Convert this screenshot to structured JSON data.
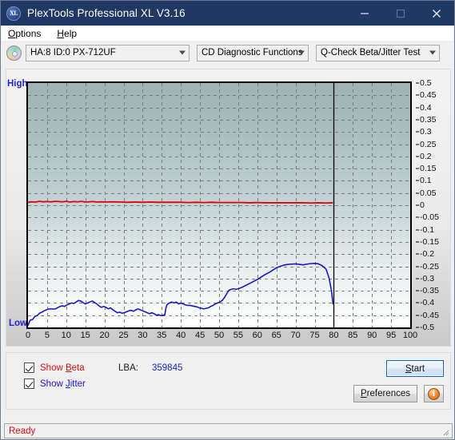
{
  "window": {
    "title": "PlexTools Professional XL V3.16",
    "icon": "XL",
    "minimize": "minimize-icon",
    "maximize": "maximize-icon",
    "close": "close-icon"
  },
  "menu": {
    "items": [
      {
        "label": "Options",
        "accel": "O"
      },
      {
        "label": "Help",
        "accel": "H"
      }
    ]
  },
  "toolbar": {
    "device": "HA:8 ID:0  PX-712UF",
    "function": "CD Diagnostic Functions",
    "test": "Q-Check Beta/Jitter Test"
  },
  "controls": {
    "show_beta": {
      "label": "Show Beta",
      "checked": true,
      "color": "#d01010"
    },
    "show_jitter": {
      "label": "Show Jitter",
      "checked": true,
      "color": "#1818c8"
    },
    "lba_label": "LBA:",
    "lba_value": "359845",
    "start": "Start",
    "preferences": "Preferences",
    "info": "i"
  },
  "status": {
    "text": "Ready"
  },
  "chart_data": {
    "type": "line",
    "title": "Q-Check Beta/Jitter Test",
    "xlabel": "",
    "ylabel": "",
    "xlim": [
      0,
      100
    ],
    "ylim": [
      -0.5,
      0.5
    ],
    "grid": true,
    "legend_position": "bottom-left",
    "left_axis_labels": {
      "top": "High",
      "bottom": "Low"
    },
    "xticks": [
      0,
      5,
      10,
      15,
      20,
      25,
      30,
      35,
      40,
      45,
      50,
      55,
      60,
      65,
      70,
      75,
      80,
      85,
      90,
      95,
      100
    ],
    "yticks": [
      0.5,
      0.45,
      0.4,
      0.35,
      0.3,
      0.25,
      0.2,
      0.15,
      0.1,
      0.05,
      0,
      -0.05,
      -0.1,
      -0.15,
      -0.2,
      -0.25,
      -0.3,
      -0.35,
      -0.4,
      -0.45,
      -0.5
    ],
    "cursor_line_x": 80,
    "series": [
      {
        "name": "Beta",
        "color": "#e00000",
        "x": [
          0,
          1,
          2,
          3,
          4,
          5,
          6,
          7,
          8,
          9,
          10,
          11,
          12,
          13,
          14,
          15,
          16,
          17,
          18,
          19,
          20,
          22,
          24,
          26,
          28,
          30,
          32,
          34,
          36,
          38,
          40,
          42,
          44,
          46,
          48,
          50,
          52,
          54,
          56,
          58,
          60,
          62,
          64,
          66,
          68,
          70,
          72,
          74,
          76,
          78,
          79.6
        ],
        "values": [
          0.012,
          0.014,
          0.013,
          0.016,
          0.014,
          0.015,
          0.014,
          0.016,
          0.015,
          0.014,
          0.016,
          0.013,
          0.015,
          0.014,
          0.016,
          0.013,
          0.014,
          0.015,
          0.013,
          0.014,
          0.013,
          0.014,
          0.013,
          0.012,
          0.013,
          0.012,
          0.013,
          0.012,
          0.012,
          0.012,
          0.012,
          0.011,
          0.012,
          0.011,
          0.012,
          0.011,
          0.011,
          0.011,
          0.011,
          0.01,
          0.011,
          0.01,
          0.01,
          0.01,
          0.01,
          0.01,
          0.01,
          0.009,
          0.01,
          0.009,
          0.01
        ]
      },
      {
        "name": "Jitter",
        "color": "#1818c8",
        "x": [
          0,
          0.6,
          1.2,
          1.8,
          2.4,
          3.0,
          3.6,
          4.2,
          4.8,
          5.4,
          6.0,
          6.6,
          7.2,
          7.8,
          8.4,
          9.0,
          9.6,
          10.2,
          10.8,
          11.4,
          12.0,
          12.6,
          13.2,
          13.8,
          14.4,
          15.0,
          15.6,
          16.2,
          16.8,
          17.4,
          18.0,
          18.6,
          19.2,
          19.8,
          20.4,
          21.0,
          21.6,
          22.2,
          22.8,
          23.4,
          24.0,
          24.6,
          25.2,
          25.8,
          26.4,
          27.0,
          27.6,
          28.2,
          28.8,
          29.4,
          30.0,
          30.6,
          31.2,
          31.8,
          32.4,
          33.0,
          33.6,
          34.2,
          34.8,
          35.4,
          35.8,
          36.1,
          36.4,
          37.0,
          37.6,
          38.2,
          38.8,
          39.4,
          40.0,
          40.6,
          41.2,
          41.8,
          42.4,
          43.0,
          43.6,
          44.2,
          44.8,
          45.4,
          46.0,
          46.6,
          47.2,
          47.8,
          48.4,
          49.0,
          49.6,
          50.2,
          50.8,
          51.4,
          52.0,
          52.6,
          53.2,
          53.8,
          54.4,
          55.0,
          56.0,
          57.0,
          58.0,
          59.0,
          60.0,
          61.0,
          62.0,
          63.0,
          64.0,
          65.0,
          66.0,
          67.0,
          68.0,
          69.0,
          70.0,
          71.0,
          72.0,
          73.0,
          74.0,
          75.0,
          76.0,
          77.0,
          78.0,
          78.8,
          79.4,
          79.8
        ],
        "values": [
          -0.492,
          -0.47,
          -0.468,
          -0.455,
          -0.452,
          -0.442,
          -0.438,
          -0.432,
          -0.428,
          -0.425,
          -0.424,
          -0.425,
          -0.424,
          -0.419,
          -0.414,
          -0.412,
          -0.414,
          -0.408,
          -0.404,
          -0.4,
          -0.402,
          -0.396,
          -0.39,
          -0.392,
          -0.398,
          -0.404,
          -0.4,
          -0.396,
          -0.392,
          -0.398,
          -0.404,
          -0.412,
          -0.418,
          -0.414,
          -0.418,
          -0.424,
          -0.42,
          -0.428,
          -0.434,
          -0.44,
          -0.438,
          -0.442,
          -0.44,
          -0.436,
          -0.432,
          -0.43,
          -0.434,
          -0.428,
          -0.424,
          -0.428,
          -0.432,
          -0.436,
          -0.44,
          -0.444,
          -0.44,
          -0.444,
          -0.45,
          -0.448,
          -0.452,
          -0.45,
          -0.448,
          -0.42,
          -0.406,
          -0.4,
          -0.396,
          -0.4,
          -0.396,
          -0.404,
          -0.4,
          -0.404,
          -0.408,
          -0.41,
          -0.41,
          -0.412,
          -0.414,
          -0.416,
          -0.42,
          -0.422,
          -0.424,
          -0.422,
          -0.42,
          -0.414,
          -0.41,
          -0.404,
          -0.4,
          -0.396,
          -0.39,
          -0.378,
          -0.362,
          -0.348,
          -0.344,
          -0.342,
          -0.344,
          -0.342,
          -0.336,
          -0.328,
          -0.32,
          -0.312,
          -0.304,
          -0.294,
          -0.284,
          -0.276,
          -0.266,
          -0.256,
          -0.25,
          -0.245,
          -0.242,
          -0.241,
          -0.24,
          -0.242,
          -0.244,
          -0.241,
          -0.239,
          -0.238,
          -0.24,
          -0.248,
          -0.262,
          -0.3,
          -0.35,
          -0.404
        ]
      }
    ]
  }
}
